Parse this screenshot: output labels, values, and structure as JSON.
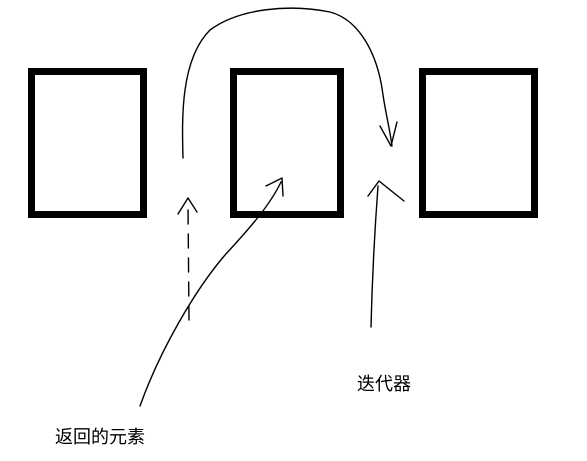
{
  "labels": {
    "returned_element": "返回的元素",
    "iterator": "迭代器"
  },
  "boxes": [
    {
      "id": "element-1"
    },
    {
      "id": "element-2"
    },
    {
      "id": "element-3"
    }
  ],
  "colors": {
    "background": "#ffffff",
    "ink": "#000000"
  }
}
